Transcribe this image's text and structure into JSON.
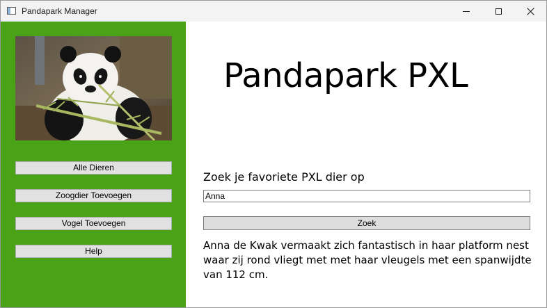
{
  "window": {
    "title": "Pandapark Manager",
    "controls": [
      "minimize",
      "maximize",
      "close"
    ]
  },
  "sidebar": {
    "image": {
      "subject": "panda-eating-bamboo"
    },
    "buttons": [
      {
        "label": "Alle Dieren"
      },
      {
        "label": "Zoogdier Toevoegen"
      },
      {
        "label": "Vogel Toevoegen"
      },
      {
        "label": "Help"
      }
    ],
    "background_color": "#4aa317"
  },
  "main": {
    "title": "Pandapark PXL",
    "search_label": "Zoek je favoriete PXL dier op",
    "search_value": "Anna",
    "search_button_label": "Zoek",
    "result_text": "Anna de Kwak vermaakt zich fantastisch in haar platform nest waar zij rond vliegt met met haar vleugels met een spanwijdte van 112 cm."
  }
}
